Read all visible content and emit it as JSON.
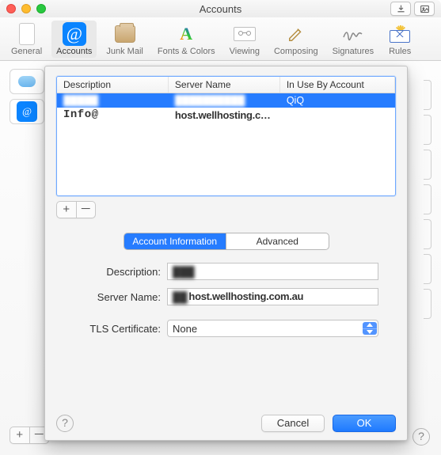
{
  "window": {
    "title": "Accounts"
  },
  "toolbar": [
    {
      "id": "general",
      "label": "General"
    },
    {
      "id": "accounts",
      "label": "Accounts",
      "active": true
    },
    {
      "id": "junk",
      "label": "Junk Mail"
    },
    {
      "id": "fonts",
      "label": "Fonts & Colors"
    },
    {
      "id": "viewing",
      "label": "Viewing"
    },
    {
      "id": "composing",
      "label": "Composing"
    },
    {
      "id": "signatures",
      "label": "Signatures"
    },
    {
      "id": "rules",
      "label": "Rules"
    }
  ],
  "table": {
    "columns": [
      "Description",
      "Server Name",
      "In Use By Account"
    ],
    "rows": [
      {
        "description": "█████",
        "server": "██████████",
        "account": "QiQ",
        "selected": true,
        "redacted": true
      },
      {
        "description": "Info@",
        "server": "host.wellhosting.com.au",
        "account": ""
      }
    ]
  },
  "tabs": {
    "account_info": "Account Information",
    "advanced": "Advanced",
    "active": "account_info"
  },
  "form": {
    "description_label": "Description:",
    "description_value": "███",
    "server_label": "Server Name:",
    "server_value_redacted": "██",
    "server_value": "host.wellhosting.com.au",
    "tls_label": "TLS Certificate:",
    "tls_value": "None"
  },
  "buttons": {
    "cancel": "Cancel",
    "ok": "OK"
  }
}
